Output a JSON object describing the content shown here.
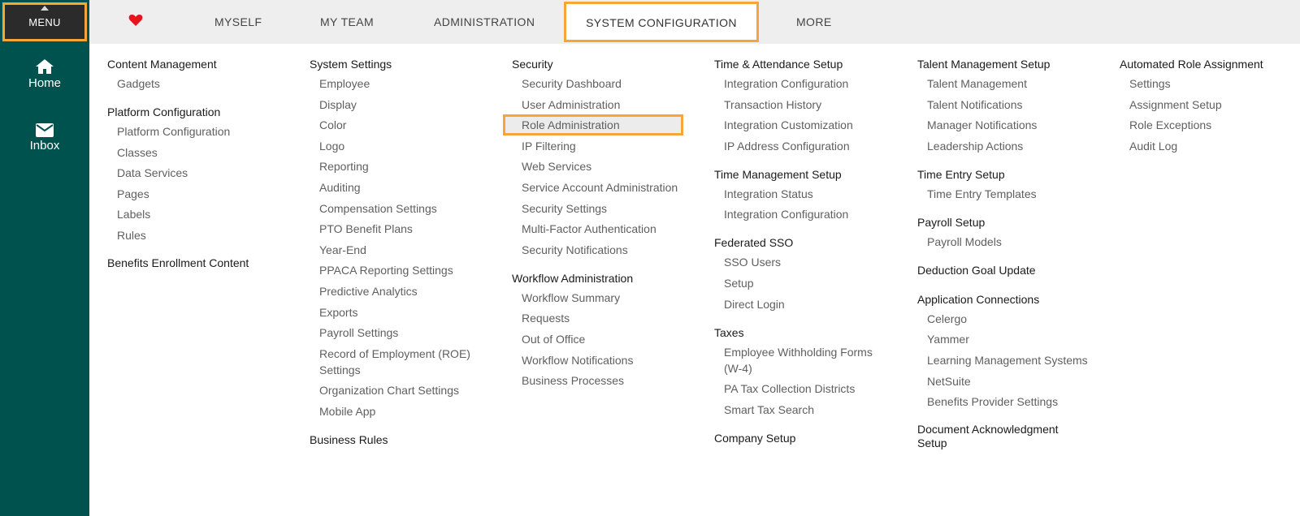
{
  "rail": {
    "menu_label": "MENU",
    "home_label": "Home",
    "inbox_label": "Inbox"
  },
  "topnav": {
    "items": [
      "MYSELF",
      "MY TEAM",
      "ADMINISTRATION",
      "SYSTEM CONFIGURATION",
      "MORE"
    ]
  },
  "colors": {
    "rail": "#00524f",
    "highlight": "#f7a536",
    "heart": "#e8131b"
  },
  "columns": [
    [
      {
        "title": "Content Management",
        "items": [
          "Gadgets"
        ]
      },
      {
        "title": "Platform Configuration",
        "items": [
          "Platform Configuration",
          "Classes",
          "Data Services",
          "Pages",
          "Labels",
          "Rules"
        ]
      },
      {
        "title": "Benefits Enrollment Content",
        "items": []
      }
    ],
    [
      {
        "title": "System Settings",
        "items": [
          "Employee",
          "Display",
          "Color",
          "Logo",
          "Reporting",
          "Auditing",
          "Compensation Settings",
          "PTO Benefit Plans",
          "Year-End",
          "PPACA Reporting Settings",
          "Predictive Analytics",
          "Exports",
          "Payroll Settings",
          "Record of Employment (ROE) Settings",
          "Organization Chart Settings",
          "Mobile App"
        ]
      },
      {
        "title": "Business Rules",
        "items": []
      }
    ],
    [
      {
        "title": "Security",
        "items": [
          "Security Dashboard",
          "User Administration",
          "Role Administration",
          "IP Filtering",
          "Web Services",
          "Service Account Administration",
          "Security Settings",
          "Multi-Factor Authentication",
          "Security Notifications"
        ]
      },
      {
        "title": "Workflow Administration",
        "items": [
          "Workflow Summary",
          "Requests",
          "Out of Office",
          "Workflow Notifications",
          "Business Processes"
        ]
      }
    ],
    [
      {
        "title": "Time & Attendance Setup",
        "items": [
          "Integration Configuration",
          "Transaction History",
          "Integration Customization",
          "IP Address Configuration"
        ]
      },
      {
        "title": "Time Management Setup",
        "items": [
          "Integration Status",
          "Integration Configuration"
        ]
      },
      {
        "title": "Federated SSO",
        "items": [
          "SSO Users",
          "Setup",
          "Direct Login"
        ]
      },
      {
        "title": "Taxes",
        "items": [
          "Employee Withholding Forms (W-4)",
          "PA Tax Collection Districts",
          "Smart Tax Search"
        ]
      },
      {
        "title": "Company Setup",
        "items": []
      }
    ],
    [
      {
        "title": "Talent Management Setup",
        "items": [
          "Talent Management",
          "Talent Notifications",
          "Manager Notifications",
          "Leadership Actions"
        ]
      },
      {
        "title": "Time Entry Setup",
        "items": [
          "Time Entry Templates"
        ]
      },
      {
        "title": "Payroll Setup",
        "items": [
          "Payroll Models"
        ]
      },
      {
        "title": "Deduction Goal Update",
        "items": []
      },
      {
        "title": "Application Connections",
        "items": [
          "Celergo",
          "Yammer",
          "Learning Management Systems",
          "NetSuite",
          "Benefits Provider Settings"
        ]
      },
      {
        "title": "Document Acknowledgment Setup",
        "items": []
      }
    ],
    [
      {
        "title": "Automated Role Assignment",
        "items": [
          "Settings",
          "Assignment Setup",
          "Role Exceptions",
          "Audit Log"
        ]
      }
    ]
  ],
  "highlighted_item": "Role Administration"
}
